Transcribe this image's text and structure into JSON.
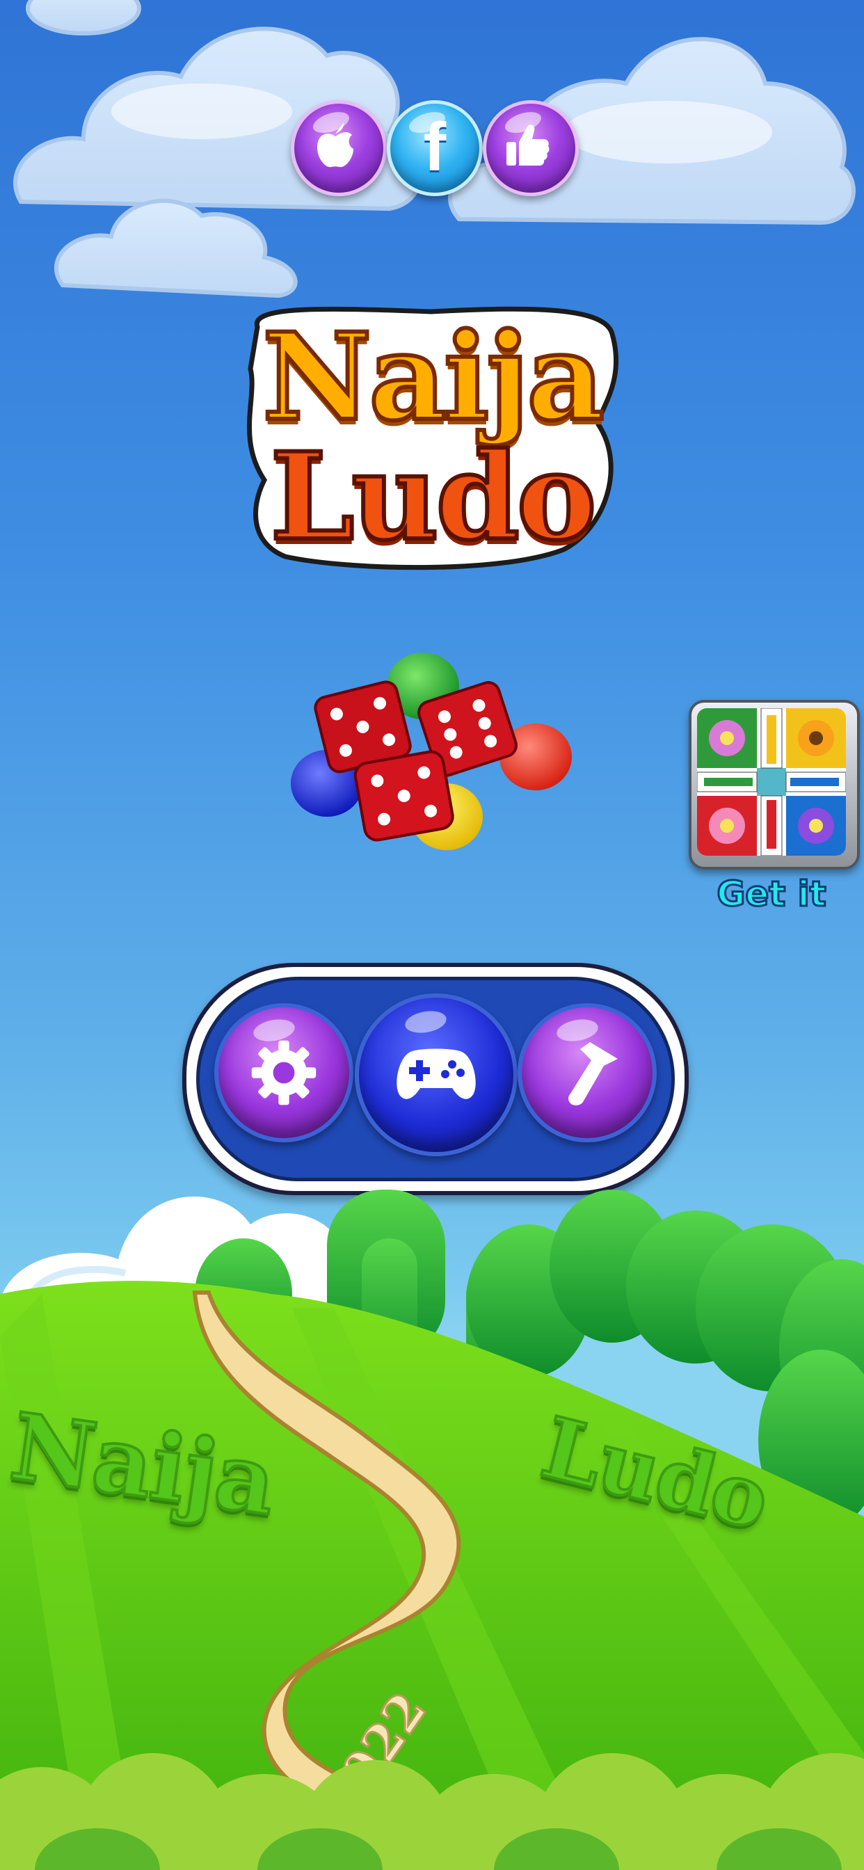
{
  "social": {
    "buttons": [
      {
        "name": "apple",
        "icon": "apple-icon",
        "color": "#9c3fe0"
      },
      {
        "name": "facebook",
        "icon": "facebook-icon",
        "label": "f",
        "color": "#31b4f2"
      },
      {
        "name": "like",
        "icon": "thumbs-up-icon",
        "color": "#9c3fe0"
      }
    ]
  },
  "logo": {
    "line1": "Naija",
    "line2": "Ludo",
    "line1_color": "#ffb000",
    "line2_color": "#f25a12"
  },
  "promo": {
    "label": "Get it",
    "image": "ludo-board-thumbnail"
  },
  "menu": {
    "buttons": [
      {
        "name": "settings",
        "icon": "gear-icon"
      },
      {
        "name": "play",
        "icon": "gamepad-icon"
      },
      {
        "name": "share",
        "icon": "arrow-up-right-icon"
      }
    ]
  },
  "landscape": {
    "left_word": "Naija",
    "right_word": "Ludo",
    "path_year": "2022"
  },
  "colors": {
    "sky_top": "#2f74d6",
    "grass": "#5fce18",
    "path": "#f4dd9e",
    "menu_ring": "#1f49b5"
  }
}
